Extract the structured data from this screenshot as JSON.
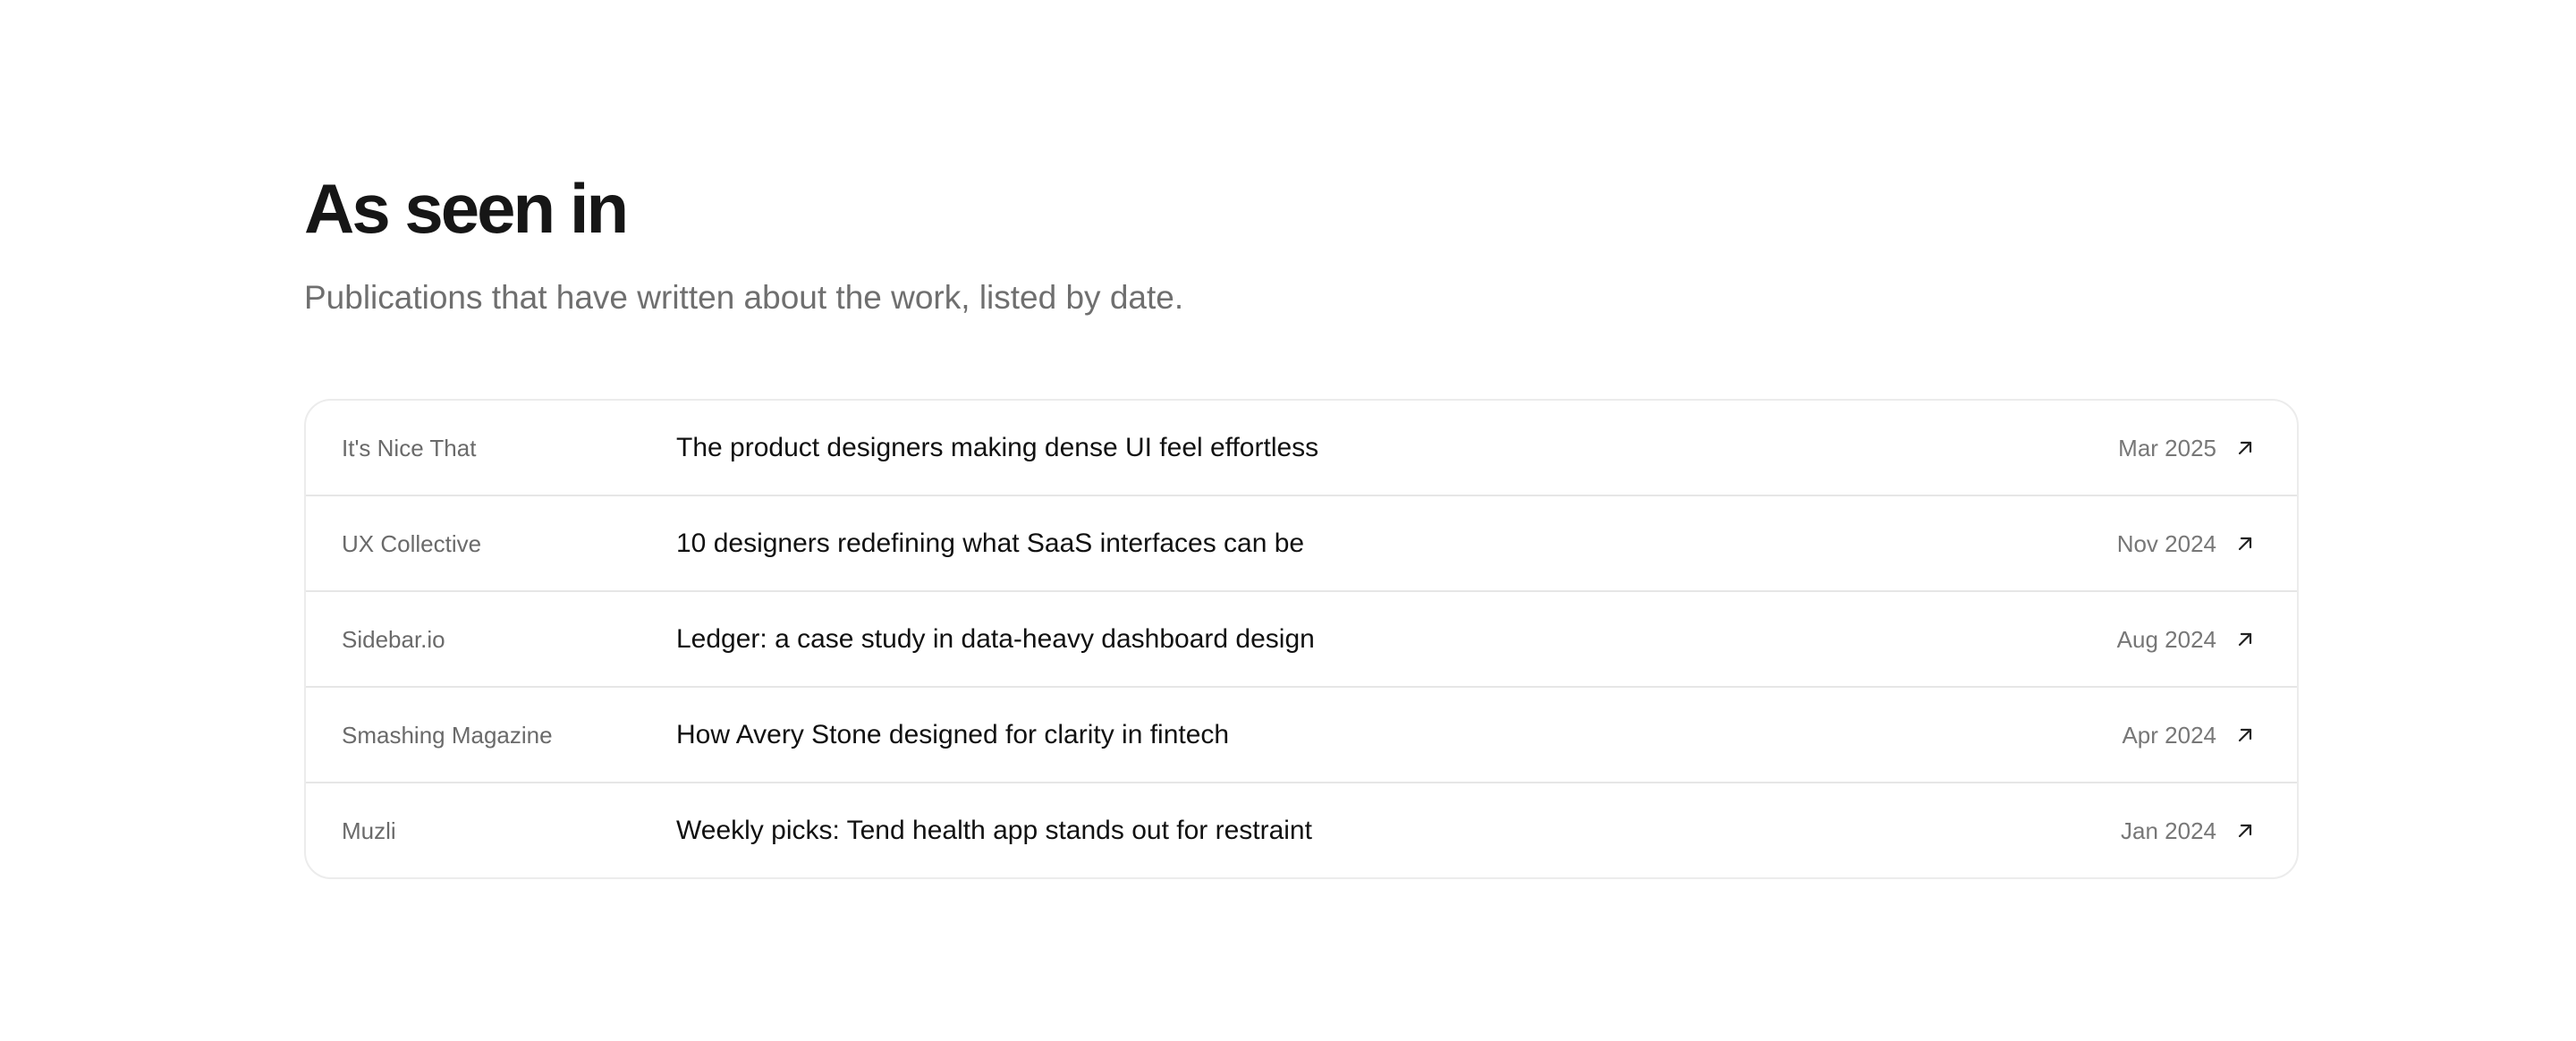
{
  "header": {
    "title": "As seen in",
    "subtitle": "Publications that have written about the work, listed by date."
  },
  "press": {
    "items": [
      {
        "publication": "It's Nice That",
        "headline": "The product designers making dense UI feel effortless",
        "date": "Mar 2025",
        "icon": "arrow-up-right-icon"
      },
      {
        "publication": "UX Collective",
        "headline": "10 designers redefining what SaaS interfaces can be",
        "date": "Nov 2024",
        "icon": "arrow-up-right-icon"
      },
      {
        "publication": "Sidebar.io",
        "headline": "Ledger: a case study in data-heavy dashboard design",
        "date": "Aug 2024",
        "icon": "arrow-up-right-icon"
      },
      {
        "publication": "Smashing Magazine",
        "headline": "How Avery Stone designed for clarity in fintech",
        "date": "Apr 2024",
        "icon": "arrow-up-right-icon"
      },
      {
        "publication": "Muzli",
        "headline": "Weekly picks: Tend health app stands out for restraint",
        "date": "Jan 2024",
        "icon": "arrow-up-right-icon"
      }
    ]
  },
  "colors": {
    "background": "#ffffff",
    "title": "#161616",
    "subtitle": "#6f6f6f",
    "publication": "#6a6a6a",
    "headline": "#111111",
    "date": "#777777",
    "border": "#e6e6e6"
  }
}
